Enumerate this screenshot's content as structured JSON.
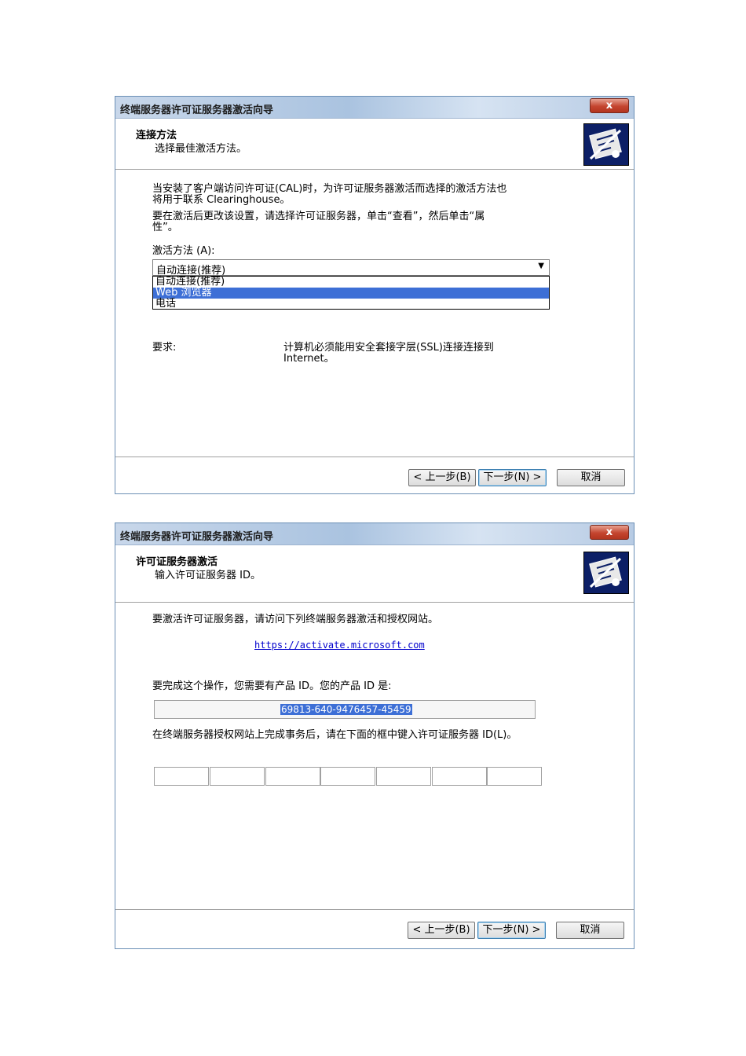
{
  "dialog1": {
    "title": "终端服务器许可证服务器激活向导",
    "close_label": "x",
    "header_title": "连接方法",
    "header_subtitle": "选择最佳激活方法。",
    "para1_line1": "当安装了客户端访问许可证(CAL)时，为许可证服务器激活而选择的激活方法也",
    "para1_line2": "将用于联系 Clearinghouse。",
    "para2_line1": "要在激活后更改该设置，请选择许可证服务器，单击“查看”，然后单击“属",
    "para2_line2": "性”。",
    "method_label": "激活方法 (A):",
    "selected_value": "自动连接(推荐)",
    "options": [
      "自动连接(推荐)",
      "Web 浏览器",
      "电话"
    ],
    "highlighted_option": "Web 浏览器",
    "requirement_label": "要求:",
    "requirement_line1": "计算机必须能用安全套接字层(SSL)连接连接到",
    "requirement_line2": "Internet。",
    "back_button": "< 上一步(B)",
    "next_button": "下一步(N) >",
    "cancel_button": "取消"
  },
  "dialog2": {
    "title": "终端服务器许可证服务器激活向导",
    "close_label": "x",
    "header_title": "许可证服务器激活",
    "header_subtitle": "输入许可证服务器 ID。",
    "instruction": "要激活许可证服务器，请访问下列终端服务器激活和授权网站。",
    "url": "https://activate.microsoft.com",
    "product_id_prompt": "要完成这个操作，您需要有产品 ID。您的产品 ID 是:",
    "product_id": "69813-640-9476457-45459",
    "server_id_prompt": "在终端服务器授权网站上完成事务后，请在下面的框中键入许可证服务器 ID(L)。",
    "back_button": "< 上一步(B)",
    "next_button": "下一步(N) >",
    "cancel_button": "取消"
  },
  "icons": {
    "wizard": "certificate-wizard-icon",
    "close": "close-icon"
  }
}
